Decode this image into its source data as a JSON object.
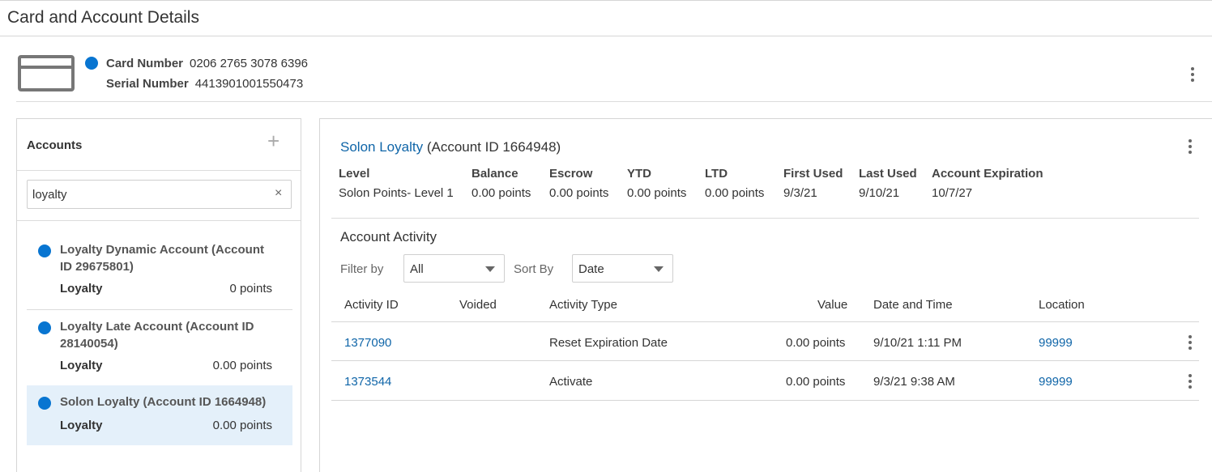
{
  "page": {
    "title": "Card and Account Details"
  },
  "card": {
    "card_number_label": "Card Number",
    "card_number": "0206 2765 3078 6396",
    "serial_number_label": "Serial Number",
    "serial_number": "4413901001550473",
    "status_color": "#0875d1"
  },
  "accounts": {
    "title": "Accounts",
    "add_icon": "+",
    "search": {
      "value": "loyalty",
      "clear_icon": "×"
    },
    "items": [
      {
        "name": "Loyalty Dynamic Account (Account ID 29675801)",
        "type": "Loyalty",
        "points": "0 points"
      },
      {
        "name": "Loyalty Late Account (Account ID 28140054)",
        "type": "Loyalty",
        "points": "0.00 points"
      },
      {
        "name": "Solon Loyalty (Account ID 1664948)",
        "type": "Loyalty",
        "points": "0.00 points",
        "selected": true
      }
    ]
  },
  "details": {
    "account_name": "Solon Loyalty",
    "account_id_text": "(Account ID 1664948)",
    "summary": {
      "level_label": "Level",
      "level": "Solon Points- Level 1",
      "balance_label": "Balance",
      "balance": "0.00 points",
      "escrow_label": "Escrow",
      "escrow": "0.00 points",
      "ytd_label": "YTD",
      "ytd": "0.00 points",
      "ltd_label": "LTD",
      "ltd": "0.00 points",
      "first_used_label": "First Used",
      "first_used": "9/3/21",
      "last_used_label": "Last Used",
      "last_used": "9/10/21",
      "expiration_label": "Account Expiration",
      "expiration": "10/7/27"
    },
    "activity": {
      "title": "Account Activity",
      "filter_label": "Filter by",
      "filter_value": "All",
      "sort_label": "Sort By",
      "sort_value": "Date",
      "columns": {
        "activity_id": "Activity ID",
        "voided": "Voided",
        "activity_type": "Activity Type",
        "value": "Value",
        "date_time": "Date and Time",
        "location": "Location"
      },
      "rows": [
        {
          "activity_id": "1377090",
          "voided": "",
          "activity_type": "Reset Expiration Date",
          "value": "0.00 points",
          "date_time": "9/10/21 1:11 PM",
          "location": "99999"
        },
        {
          "activity_id": "1373544",
          "voided": "",
          "activity_type": "Activate",
          "value": "0.00 points",
          "date_time": "9/3/21 9:38 AM",
          "location": "99999"
        }
      ]
    }
  },
  "colors": {
    "accent": "#0875d1",
    "link": "#0f65a8",
    "selected_bg": "#e4f0fa"
  }
}
